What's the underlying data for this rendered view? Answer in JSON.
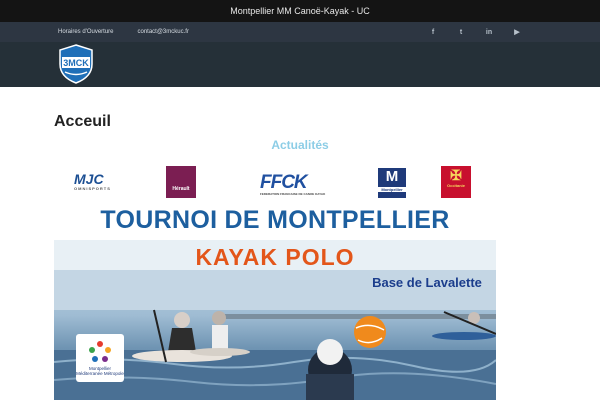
{
  "site": {
    "title": "Montpellier MM Canoë-Kayak - UC"
  },
  "subbar": {
    "links": [
      "Horaires d'Ouverture",
      "contact@3mckuc.fr"
    ],
    "social": [
      {
        "icon": "facebook-icon",
        "glyph": "f"
      },
      {
        "icon": "twitter-icon",
        "glyph": "t"
      },
      {
        "icon": "linkedin-icon",
        "glyph": "in"
      },
      {
        "icon": "youtube-icon",
        "glyph": "▶"
      }
    ]
  },
  "logo": {
    "text": "3MCK"
  },
  "page": {
    "title": "Acceuil",
    "section": "Actualités"
  },
  "poster": {
    "sponsors": {
      "mjc": "MJC",
      "mjc_sub": "OMNISPORTS",
      "herault": "Hérault",
      "ffck": "FFCK",
      "ffck_sub": "FEDERATION FRANCAISE DE CANOE KAYAK",
      "metro": "M",
      "metro_sub": "Montpellier",
      "occitanie": "Occitanie"
    },
    "headline1": "TOURNOI DE MONTPELLIER",
    "headline2": "KAYAK POLO",
    "venue": "Base de Lavalette",
    "metro_logo": "Montpellier Méditerranée Métropole"
  },
  "colors": {
    "topbar": "#141414",
    "subbar": "#2d3642",
    "header": "#253038",
    "section": "#8ccde6",
    "headline1": "#1d5f9f",
    "headline2": "#e3561a"
  }
}
